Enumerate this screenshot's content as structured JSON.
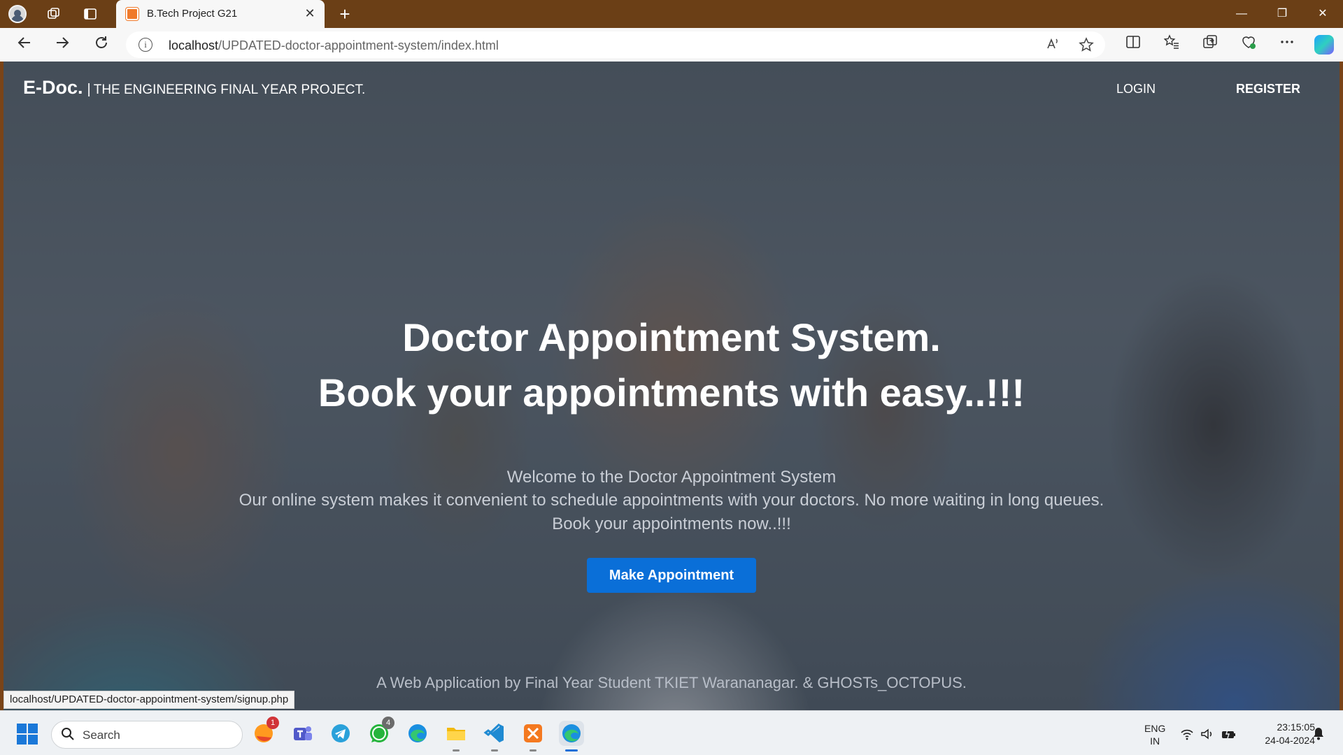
{
  "browser": {
    "tab_title": "B.Tech Project G21",
    "tab_close": "✕",
    "new_tab": "+",
    "window_controls": {
      "minimize": "—",
      "restore": "❐",
      "close": "✕"
    },
    "url_host": "localhost",
    "url_path": "/UPDATED-doctor-appointment-system/index.html",
    "info_glyph": "i",
    "status_url": "localhost/UPDATED-doctor-appointment-system/signup.php",
    "icons": [
      "profile-icon",
      "workspaces-icon",
      "tab-actions-icon",
      "back-icon",
      "forward-icon",
      "refresh-icon",
      "read-aloud-icon",
      "favorite-star-icon",
      "split-screen-icon",
      "favorites-icon",
      "collections-icon",
      "browser-essentials-icon",
      "more-icon",
      "copilot-icon"
    ]
  },
  "page": {
    "brand": "E-Doc.",
    "brand_sep": "|",
    "tagline": "THE ENGINEERING FINAL YEAR PROJECT.",
    "nav": {
      "login": "LOGIN",
      "register": "REGISTER"
    },
    "hero_title_1": "Doctor Appointment System.",
    "hero_title_2": "Book your appointments with easy..!!!",
    "welcome": "Welcome to the Doctor Appointment System",
    "description": "Our online system makes it convenient to schedule appointments with your doctors. No more waiting in long queues.",
    "call": "Book your appointments now..!!!",
    "cta": "Make Appointment",
    "footer": "A Web Application by Final Year Student TKIET Warananagar. & GHOSTs_OCTOPUS."
  },
  "taskbar": {
    "search_placeholder": "Search",
    "apps": [
      {
        "name": "firefox-icon",
        "badge": "1"
      },
      {
        "name": "teams-icon"
      },
      {
        "name": "telegram-icon"
      },
      {
        "name": "whatsapp-icon",
        "badge": "4"
      },
      {
        "name": "edge-icon"
      },
      {
        "name": "file-explorer-icon"
      },
      {
        "name": "vscode-icon"
      },
      {
        "name": "xampp-icon"
      },
      {
        "name": "edge-active-icon"
      }
    ],
    "lang_1": "ENG",
    "lang_2": "IN",
    "time": "23:15:05",
    "date": "24-04-2024",
    "colors": {
      "accent": "#0a6fd8",
      "tab_strip": "#6b3f16"
    }
  }
}
